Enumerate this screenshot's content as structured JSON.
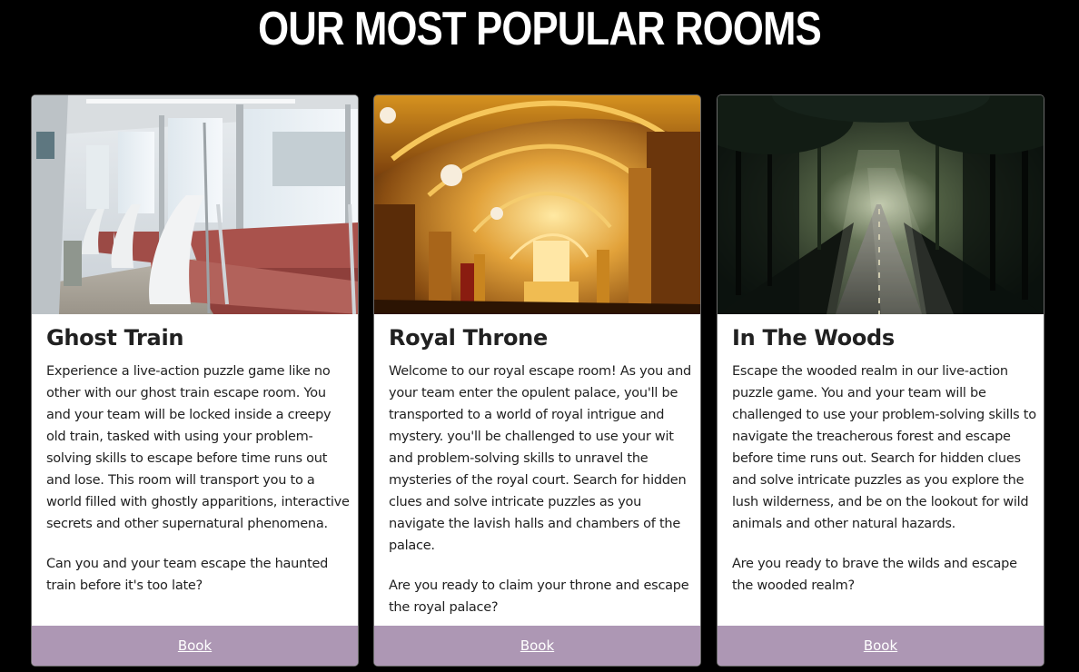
{
  "section": {
    "title": "OUR MOST POPULAR ROOMS"
  },
  "colors": {
    "background": "#000000",
    "card_background": "#ffffff",
    "button_background": "#ad97b4",
    "text": "#212121"
  },
  "rooms": [
    {
      "title": "Ghost Train",
      "description": "Experience a live-action puzzle game like no other with our ghost train escape room. You and your team will be locked inside a creepy old train, tasked with using your problem-solving skills to escape before time runs out and lose. This room will transport you to a world filled with ghostly apparitions, interactive secrets and other supernatural phenomena.",
      "question": "Can you and your team escape the haunted train before it's too late?",
      "button_label": "Book"
    },
    {
      "title": "Royal Throne",
      "description": "Welcome to our royal escape room! As you and your team enter the opulent palace, you'll be transported to a world of royal intrigue and mystery. you'll be challenged to use your wit and problem-solving skills to unravel the mysteries of the royal court. Search for hidden clues and solve intricate puzzles as you navigate the lavish halls and chambers of the palace.",
      "question": "Are you ready to claim your throne and escape the royal palace?",
      "button_label": "Book"
    },
    {
      "title": "In The Woods",
      "description": "Escape the wooded realm in our live-action puzzle game. You and your team will be challenged to use your problem-solving skills to navigate the treacherous forest and escape before time runs out. Search for hidden clues and solve intricate puzzles as you explore the lush wilderness, and be on the lookout for wild animals and other natural hazards.",
      "question": "Are you ready to brave the wilds and escape the wooded realm?",
      "button_label": "Book"
    }
  ]
}
